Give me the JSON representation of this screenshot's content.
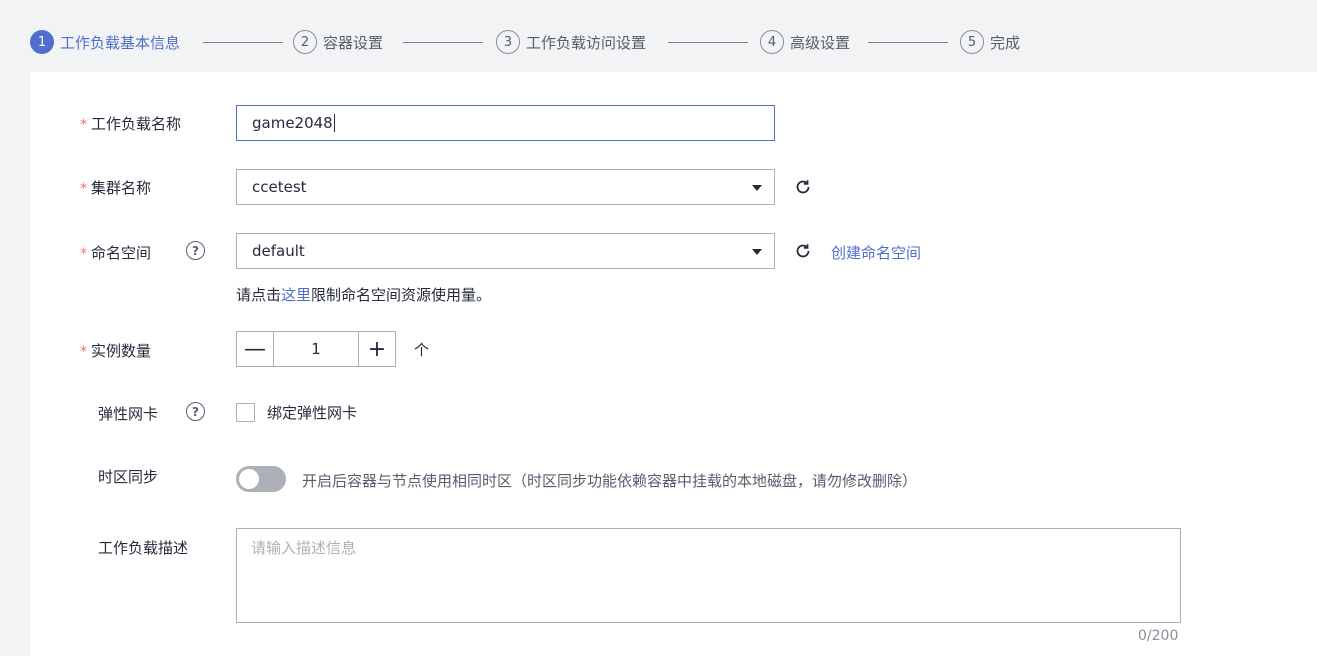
{
  "steps": [
    {
      "num": "1",
      "label": "工作负载基本信息",
      "active": true
    },
    {
      "num": "2",
      "label": "容器设置"
    },
    {
      "num": "3",
      "label": "工作负载访问设置"
    },
    {
      "num": "4",
      "label": "高级设置"
    },
    {
      "num": "5",
      "label": "完成"
    }
  ],
  "form": {
    "required_mark": "*",
    "workload_name": {
      "label": "工作负载名称",
      "value": "game2048"
    },
    "cluster": {
      "label": "集群名称",
      "value": "ccetest"
    },
    "namespace": {
      "label": "命名空间",
      "value": "default",
      "create_link": "创建命名空间"
    },
    "namespace_hint": {
      "prefix": "请点击",
      "link": "这里",
      "suffix": "限制命名空间资源使用量。"
    },
    "instances": {
      "label": "实例数量",
      "minus": "—",
      "value": "1",
      "plus": "+",
      "unit": "个"
    },
    "elastic_nic": {
      "label": "弹性网卡",
      "checkbox_label": "绑定弹性网卡"
    },
    "timezone": {
      "label": "时区同步",
      "description": "开启后容器与节点使用相同时区（时区同步功能依赖容器中挂载的本地磁盘，请勿修改删除）",
      "enabled": false
    },
    "description": {
      "label": "工作负载描述",
      "placeholder": "请输入描述信息",
      "counter": "0/200"
    },
    "help_glyph": "?"
  },
  "colors": {
    "accent": "#526ecc",
    "required": "#f66f6a"
  }
}
